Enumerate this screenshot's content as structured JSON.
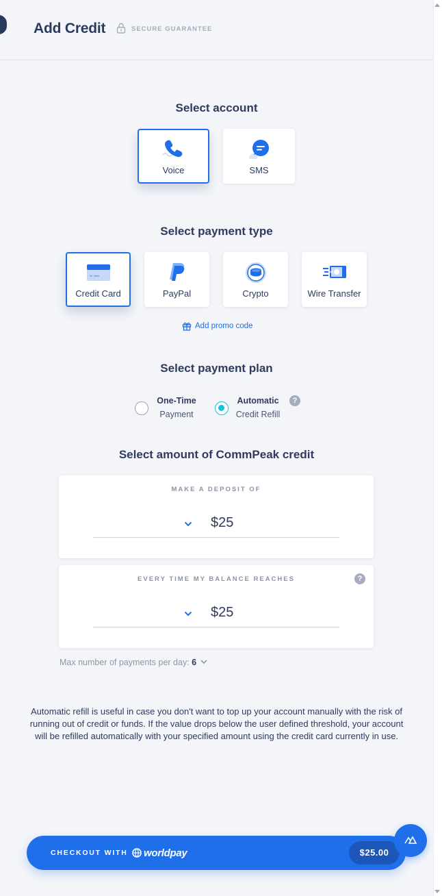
{
  "header": {
    "title": "Add Credit",
    "secure_label": "SECURE GUARANTEE"
  },
  "account": {
    "title": "Select account",
    "options": [
      {
        "label": "Voice",
        "icon": "phone-icon",
        "selected": true
      },
      {
        "label": "SMS",
        "icon": "chat-bubble-icon",
        "selected": false
      }
    ]
  },
  "payment_type": {
    "title": "Select payment type",
    "options": [
      {
        "label": "Credit Card",
        "icon": "credit-card-icon",
        "selected": true
      },
      {
        "label": "PayPal",
        "icon": "paypal-icon",
        "selected": false
      },
      {
        "label": "Crypto",
        "icon": "crypto-coin-icon",
        "selected": false
      },
      {
        "label": "Wire Transfer",
        "icon": "wire-transfer-icon",
        "selected": false
      }
    ],
    "promo_label": "Add promo code"
  },
  "plan": {
    "title": "Select payment plan",
    "options": [
      {
        "title": "One-Time",
        "subtitle": "Payment",
        "selected": false
      },
      {
        "title": "Automatic",
        "subtitle": "Credit Refill",
        "selected": true
      }
    ],
    "help": "?"
  },
  "amount": {
    "title": "Select amount of CommPeak credit",
    "deposit": {
      "label": "MAKE A DEPOSIT OF",
      "value": "$25"
    },
    "threshold": {
      "label": "EVERY TIME MY BALANCE REACHES",
      "value": "$25",
      "help": "?"
    },
    "max_payments_label": "Max number of payments per day:",
    "max_payments_value": "6"
  },
  "info": "Automatic refill is useful in case you don't want to top up your account manually with the risk of running out of credit or funds. If the value drops below the user defined threshold, your account will be refilled automatically with your specified amount using the credit card currently in use.",
  "checkout": {
    "label": "CHECKOUT WITH",
    "provider": "worldpay",
    "price": "$25.00"
  },
  "colors": {
    "accent": "#1f6fea",
    "radio_checked": "#17c3d9",
    "text": "#2f3a5c",
    "background": "#f3f5f9"
  }
}
